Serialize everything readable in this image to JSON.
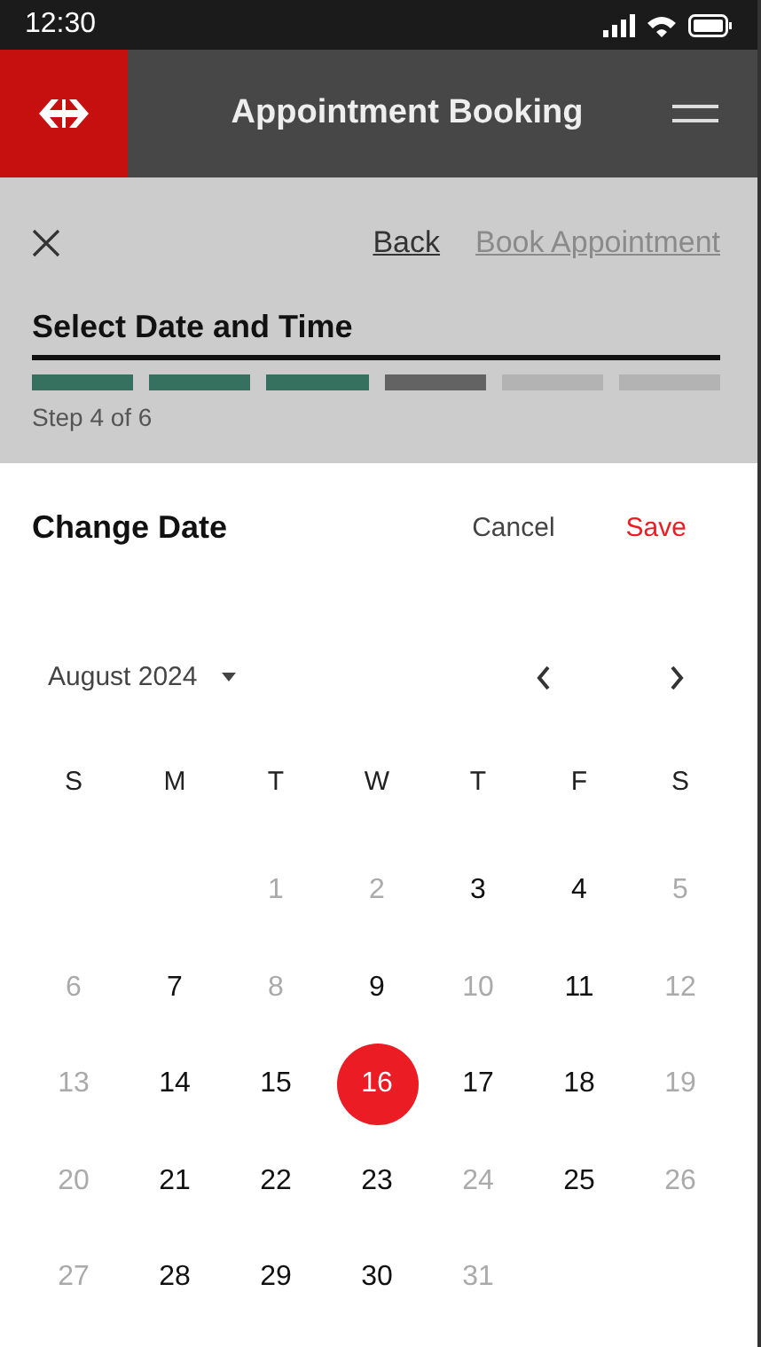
{
  "status_bar": {
    "time": "12:30"
  },
  "header": {
    "title": "Appointment Booking"
  },
  "toolbar": {
    "back": "Back",
    "next": {
      "label": "Book Appointment",
      "disabled": true
    }
  },
  "step": {
    "title": "Select Date and Time",
    "caption": "Step 4 of 6",
    "segments": [
      {
        "completed": true,
        "current": false
      },
      {
        "completed": true,
        "current": false
      },
      {
        "completed": true,
        "current": false
      },
      {
        "completed": false,
        "current": true
      },
      {
        "completed": false,
        "current": false
      },
      {
        "completed": false,
        "current": false
      }
    ]
  },
  "dialog": {
    "title": "Change Date",
    "cancel": "Cancel",
    "save": "Save",
    "month": "August 2024",
    "weekdays": [
      "S",
      "M",
      "T",
      "W",
      "T",
      "F",
      "S"
    ],
    "weeks": [
      [
        {
          "kind": "blank"
        },
        {
          "kind": "blank"
        },
        {
          "kind": "day",
          "day": "1",
          "disabled": true,
          "selected": false
        },
        {
          "kind": "day",
          "day": "2",
          "disabled": true,
          "selected": false
        },
        {
          "kind": "day",
          "day": "3",
          "disabled": false,
          "selected": false
        },
        {
          "kind": "day",
          "day": "4",
          "disabled": false,
          "selected": false
        },
        {
          "kind": "day",
          "day": "5",
          "disabled": true,
          "selected": false
        }
      ],
      [
        {
          "kind": "day",
          "day": "6",
          "disabled": true,
          "selected": false
        },
        {
          "kind": "day",
          "day": "7",
          "disabled": false,
          "selected": false
        },
        {
          "kind": "day",
          "day": "8",
          "disabled": true,
          "selected": false
        },
        {
          "kind": "day",
          "day": "9",
          "disabled": false,
          "selected": false
        },
        {
          "kind": "day",
          "day": "10",
          "disabled": true,
          "selected": false
        },
        {
          "kind": "day",
          "day": "11",
          "disabled": false,
          "selected": false
        },
        {
          "kind": "day",
          "day": "12",
          "disabled": true,
          "selected": false
        }
      ],
      [
        {
          "kind": "day",
          "day": "13",
          "disabled": true,
          "selected": false
        },
        {
          "kind": "day",
          "day": "14",
          "disabled": false,
          "selected": false
        },
        {
          "kind": "day",
          "day": "15",
          "disabled": false,
          "selected": false
        },
        {
          "kind": "day",
          "day": "16",
          "disabled": false,
          "selected": true
        },
        {
          "kind": "day",
          "day": "17",
          "disabled": false,
          "selected": false
        },
        {
          "kind": "day",
          "day": "18",
          "disabled": false,
          "selected": false
        },
        {
          "kind": "day",
          "day": "19",
          "disabled": true,
          "selected": false
        }
      ],
      [
        {
          "kind": "day",
          "day": "20",
          "disabled": true,
          "selected": false
        },
        {
          "kind": "day",
          "day": "21",
          "disabled": false,
          "selected": false
        },
        {
          "kind": "day",
          "day": "22",
          "disabled": false,
          "selected": false
        },
        {
          "kind": "day",
          "day": "23",
          "disabled": false,
          "selected": false
        },
        {
          "kind": "day",
          "day": "24",
          "disabled": true,
          "selected": false
        },
        {
          "kind": "day",
          "day": "25",
          "disabled": false,
          "selected": false
        },
        {
          "kind": "day",
          "day": "26",
          "disabled": true,
          "selected": false
        }
      ],
      [
        {
          "kind": "day",
          "day": "27",
          "disabled": true,
          "selected": false
        },
        {
          "kind": "day",
          "day": "28",
          "disabled": false,
          "selected": false
        },
        {
          "kind": "day",
          "day": "29",
          "disabled": false,
          "selected": false
        },
        {
          "kind": "day",
          "day": "30",
          "disabled": false,
          "selected": false
        },
        {
          "kind": "day",
          "day": "31",
          "disabled": true,
          "selected": false
        }
      ]
    ]
  }
}
